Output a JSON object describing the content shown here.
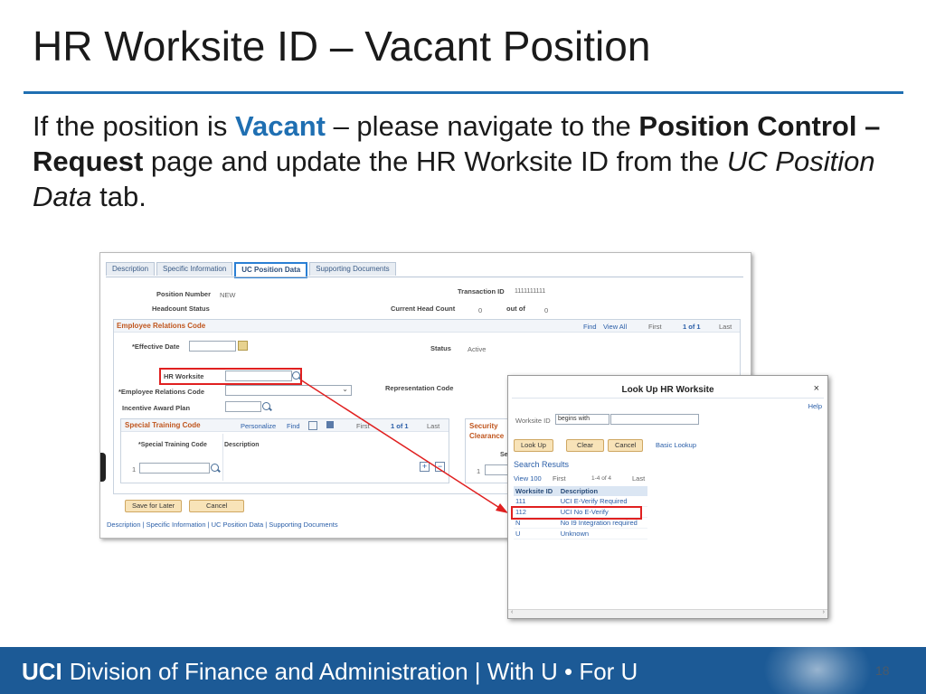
{
  "slide": {
    "title": "HR Worksite ID – Vacant Position",
    "intro": {
      "p1": "If the position is ",
      "vacant": "Vacant",
      "p2": " – please navigate to the ",
      "bold1": "Position Control – Request",
      "p3": " page and update the HR Worksite ID from the ",
      "italic1": "UC Position Data",
      "p4": " tab."
    },
    "accent_color": "#1f6fb2"
  },
  "ps_page": {
    "tabs": [
      "Description",
      "Specific Information",
      "UC Position Data",
      "Supporting Documents"
    ],
    "active_tab": "UC Position Data",
    "position_number_label": "Position Number",
    "position_number_value": "NEW",
    "transaction_id_label": "Transaction ID",
    "transaction_id_value": "1111111111",
    "headcount_status_label": "Headcount Status",
    "current_head_count_label": "Current Head Count",
    "current_head_count_value": "0",
    "out_of_label": "out of",
    "out_of_value": "0",
    "erc_section": {
      "title": "Employee Relations Code",
      "find": "Find",
      "view_all": "View All",
      "first": "First",
      "counter": "1 of 1",
      "last": "Last"
    },
    "effective_date_label": "*Effective Date",
    "status_label": "Status",
    "status_value": "Active",
    "hr_worksite_label": "HR Worksite",
    "erc_label": "*Employee Relations Code",
    "representation_code_label": "Representation Code",
    "incentive_award_label": "Incentive Award Plan",
    "stc_section": {
      "title": "Special Training Code",
      "personalize": "Personalize",
      "find": "Find",
      "first": "First",
      "counter": "1 of 1",
      "last": "Last",
      "col_code": "*Special Training Code",
      "col_desc": "Description",
      "row_num": "1"
    },
    "security_section": {
      "title_line1": "Security",
      "title_line2": "Clearance",
      "col": "Se",
      "row_num": "1"
    },
    "save_later_label": "Save for Later",
    "cancel_label": "Cancel",
    "bottom_links": [
      "Description",
      "Specific Information",
      "UC Position Data",
      "Supporting Documents"
    ]
  },
  "lookup": {
    "title": "Look Up HR Worksite",
    "close": "×",
    "help": "Help",
    "worksite_id_label": "Worksite ID",
    "operator": "begins with",
    "look_up_button": "Look Up",
    "clear_button": "Clear",
    "cancel_button": "Cancel",
    "basic_lookup": "Basic Lookup",
    "search_results": "Search Results",
    "view_100": "View 100",
    "first": "First",
    "counter": "1-4 of 4",
    "last": "Last",
    "columns": [
      "Worksite ID",
      "Description"
    ],
    "rows": [
      {
        "id": "111",
        "desc": "UCI E-Verify Required"
      },
      {
        "id": "112",
        "desc": "UCI No E-Verify"
      },
      {
        "id": "N",
        "desc": "No I9 Integration required"
      },
      {
        "id": "U",
        "desc": "Unknown"
      }
    ],
    "highlighted_row": "112"
  },
  "footer": {
    "brand_bold": "UCI",
    "brand_text": "Division of Finance and Administration | With U • For U",
    "page_number": "18",
    "bg_color": "#1c5a96"
  }
}
